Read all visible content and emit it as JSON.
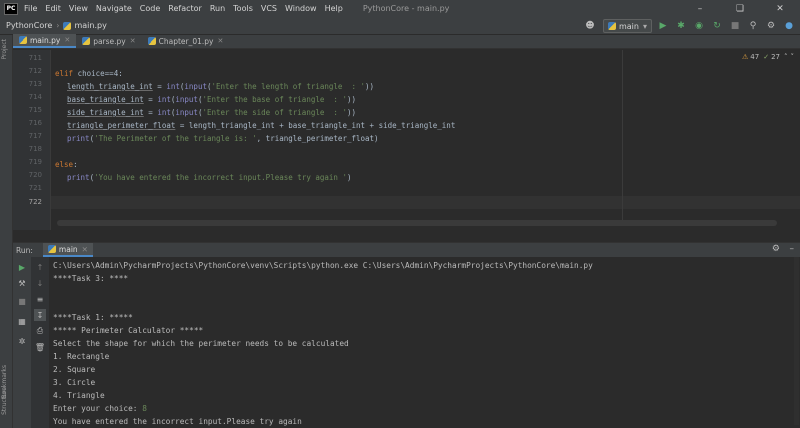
{
  "app": {
    "logo_text": "PC",
    "menu": [
      "File",
      "Edit",
      "View",
      "Navigate",
      "Code",
      "Refactor",
      "Run",
      "Tools",
      "VCS",
      "Window",
      "Help"
    ],
    "window_title": "PythonCore - main.py"
  },
  "navbar": {
    "project": "PythonCore",
    "file": "main.py",
    "run_config": "main"
  },
  "left_strip": {
    "project": "Project",
    "bookmarks": "Bookmarks",
    "structure": "Structure"
  },
  "editor": {
    "tabs": [
      {
        "label": "main.py",
        "active": true
      },
      {
        "label": "parse.py",
        "active": false
      },
      {
        "label": "Chapter_01.py",
        "active": false
      }
    ],
    "inspection": {
      "warnings": "47",
      "weak_warnings": "27"
    },
    "line_numbers": [
      "711",
      "712",
      "713",
      "714",
      "715",
      "716",
      "717",
      "718",
      "719",
      "720",
      "721",
      "722"
    ],
    "lines": {
      "l712": {
        "kw": "elif",
        "rest": " choice==4:"
      },
      "l713": {
        "var": "length_triangle_int",
        "mid": " = ",
        "fn1": "int",
        "p1": "(",
        "fn2": "input",
        "p2": "(",
        "str": "'Enter the length of triangle  : '",
        "end": "))"
      },
      "l714": {
        "var": "base_triangle_int",
        "mid": " = ",
        "fn1": "int",
        "p1": "(",
        "fn2": "input",
        "p2": "(",
        "str": "'Enter the base of triangle  : '",
        "end": "))"
      },
      "l715": {
        "var": "side_triangle_int",
        "mid": " = ",
        "fn1": "int",
        "p1": "(",
        "fn2": "input",
        "p2": "(",
        "str": "'Enter the side of triangle  : '",
        "end": "))"
      },
      "l716": {
        "var": "triangle_perimeter_float",
        "rest": " = length_triangle_int + base_triangle_int + side_triangle_int"
      },
      "l717": {
        "fn": "print",
        "p": "(",
        "str": "'The Perimeter of the triangle is: '",
        "rest": ", triangle_perimeter_float)"
      },
      "l719": {
        "kw": "else",
        "rest": ":"
      },
      "l720": {
        "fn": "print",
        "p": "(",
        "str": "'You have entered the incorrect input.Please try again '",
        "end": ")"
      }
    }
  },
  "run": {
    "label": "Run:",
    "tab": "main",
    "console": [
      "C:\\Users\\Admin\\PycharmProjects\\PythonCore\\venv\\Scripts\\python.exe C:\\Users\\Admin\\PycharmProjects\\PythonCore\\main.py",
      "****Task 3: ****",
      "",
      "",
      "****Task 1: *****",
      "***** Perimeter Calculator *****",
      "Select the shape for which the perimeter needs to be calculated",
      "1. Rectangle",
      "2. Square",
      "3. Circle",
      "4. Triangle"
    ],
    "prompt": "Enter your choice: ",
    "input_value": "8",
    "last_line": "You have entered the incorrect input.Please try again"
  }
}
